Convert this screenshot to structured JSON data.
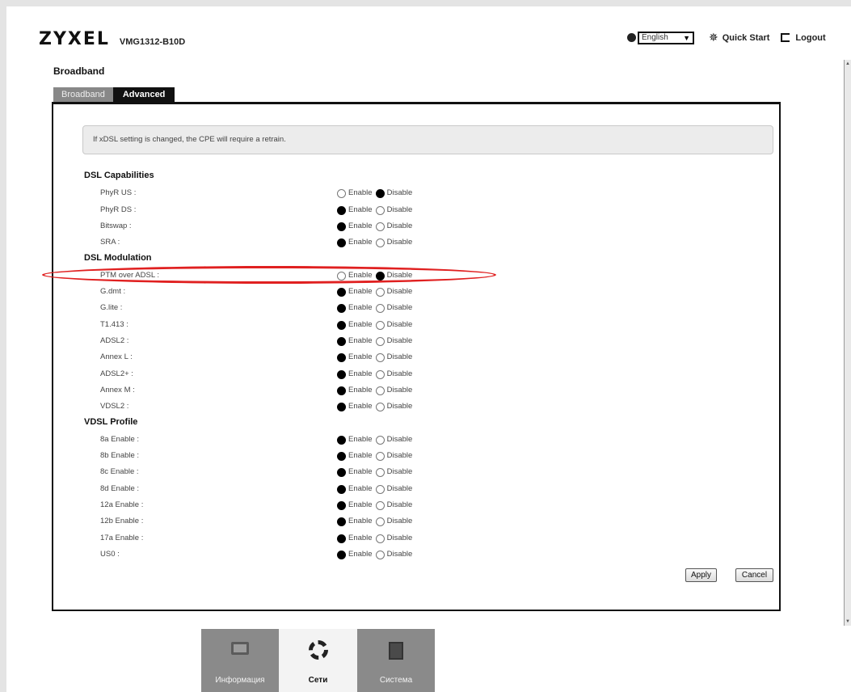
{
  "header": {
    "logo": "ZYXEL",
    "model": "VMG1312-B10D",
    "language": "English",
    "quick_start": "Quick Start",
    "logout": "Logout"
  },
  "page_title": "Broadband",
  "tabs": [
    {
      "label": "Broadband",
      "active": false
    },
    {
      "label": "Advanced",
      "active": true
    }
  ],
  "notice": "If xDSL setting is changed, the CPE will require a retrain.",
  "options": {
    "enable": "Enable",
    "disable": "Disable"
  },
  "sections": [
    {
      "title": "DSL Capabilities",
      "rows": [
        {
          "label": "PhyR US :",
          "value": "Disable"
        },
        {
          "label": "PhyR DS :",
          "value": "Enable"
        },
        {
          "label": "Bitswap :",
          "value": "Enable"
        },
        {
          "label": "SRA :",
          "value": "Enable"
        }
      ]
    },
    {
      "title": "DSL Modulation",
      "rows": [
        {
          "label": "PTM over ADSL :",
          "value": "Disable"
        },
        {
          "label": "G.dmt :",
          "value": "Enable"
        },
        {
          "label": "G.lite :",
          "value": "Enable"
        },
        {
          "label": "T1.413 :",
          "value": "Enable"
        },
        {
          "label": "ADSL2 :",
          "value": "Enable"
        },
        {
          "label": "Annex L :",
          "value": "Enable"
        },
        {
          "label": "ADSL2+ :",
          "value": "Enable"
        },
        {
          "label": "Annex M :",
          "value": "Enable"
        },
        {
          "label": "VDSL2 :",
          "value": "Enable"
        }
      ]
    },
    {
      "title": "VDSL Profile",
      "rows": [
        {
          "label": "8a Enable :",
          "value": "Enable"
        },
        {
          "label": "8b Enable :",
          "value": "Enable"
        },
        {
          "label": "8c Enable :",
          "value": "Enable"
        },
        {
          "label": "8d Enable :",
          "value": "Enable"
        },
        {
          "label": "12a Enable :",
          "value": "Enable"
        },
        {
          "label": "12b Enable :",
          "value": "Enable"
        },
        {
          "label": "17a Enable :",
          "value": "Enable"
        },
        {
          "label": "US0 :",
          "value": "Enable"
        }
      ]
    }
  ],
  "buttons": {
    "apply": "Apply",
    "cancel": "Cancel"
  },
  "bottom_nav": [
    {
      "label": "Информация",
      "icon": "monitor-icon",
      "active": false
    },
    {
      "label": "Сети",
      "icon": "gear-icon",
      "active": true
    },
    {
      "label": "Система",
      "icon": "system-icon",
      "active": false
    }
  ],
  "colors": {
    "highlight": "#e02020",
    "tab_active": "#111111",
    "tab_inactive": "#888888"
  }
}
